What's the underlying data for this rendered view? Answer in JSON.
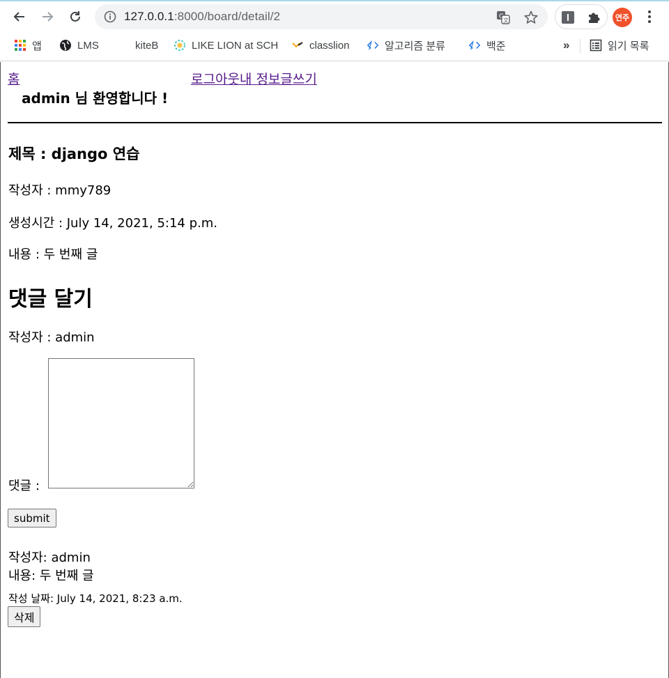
{
  "browser": {
    "url_host": "127.0.0.1",
    "url_path": ":8000/board/detail/2",
    "profile_label": "연주",
    "bookmarks": [
      {
        "label": "앱",
        "icon": "apps-grid-icon"
      },
      {
        "label": "LMS",
        "icon": "globe-icon"
      },
      {
        "label": "kiteB",
        "icon": "blank-icon"
      },
      {
        "label": "LIKE LION at SCH",
        "icon": "lion-icon"
      },
      {
        "label": "classlion",
        "icon": "classlion-icon"
      },
      {
        "label": "알고리즘 분류",
        "icon": "code-icon"
      },
      {
        "label": "백준",
        "icon": "code-icon"
      }
    ],
    "overflow_label": "»",
    "reading_list_label": "읽기 목록"
  },
  "nav": {
    "home": "홈",
    "logout_mypage_write": "로그아웃내 정보글쓰기"
  },
  "welcome": "admin 님 환영합니다 !",
  "post": {
    "title": "제목 : django 연습",
    "author": "작성자 : mmy789",
    "created": "생성시간 : July 14, 2021, 5:14 p.m.",
    "content": "내용 : 두 번째 글"
  },
  "comment_form": {
    "heading": "댓글 달기",
    "author": "작성자 : admin",
    "comment_label": "댓글 :",
    "comment_value": "",
    "submit_label": "submit"
  },
  "comments": [
    {
      "author": "작성자: admin",
      "content": "내용: 두 번째 글",
      "date": "작성 날짜: July 14, 2021, 8:23 a.m.",
      "delete_label": "삭제"
    }
  ],
  "colors": {
    "visited_link": "#551a8b",
    "profile": "#f0522a",
    "omnibox_bg": "#f1f3f4"
  }
}
